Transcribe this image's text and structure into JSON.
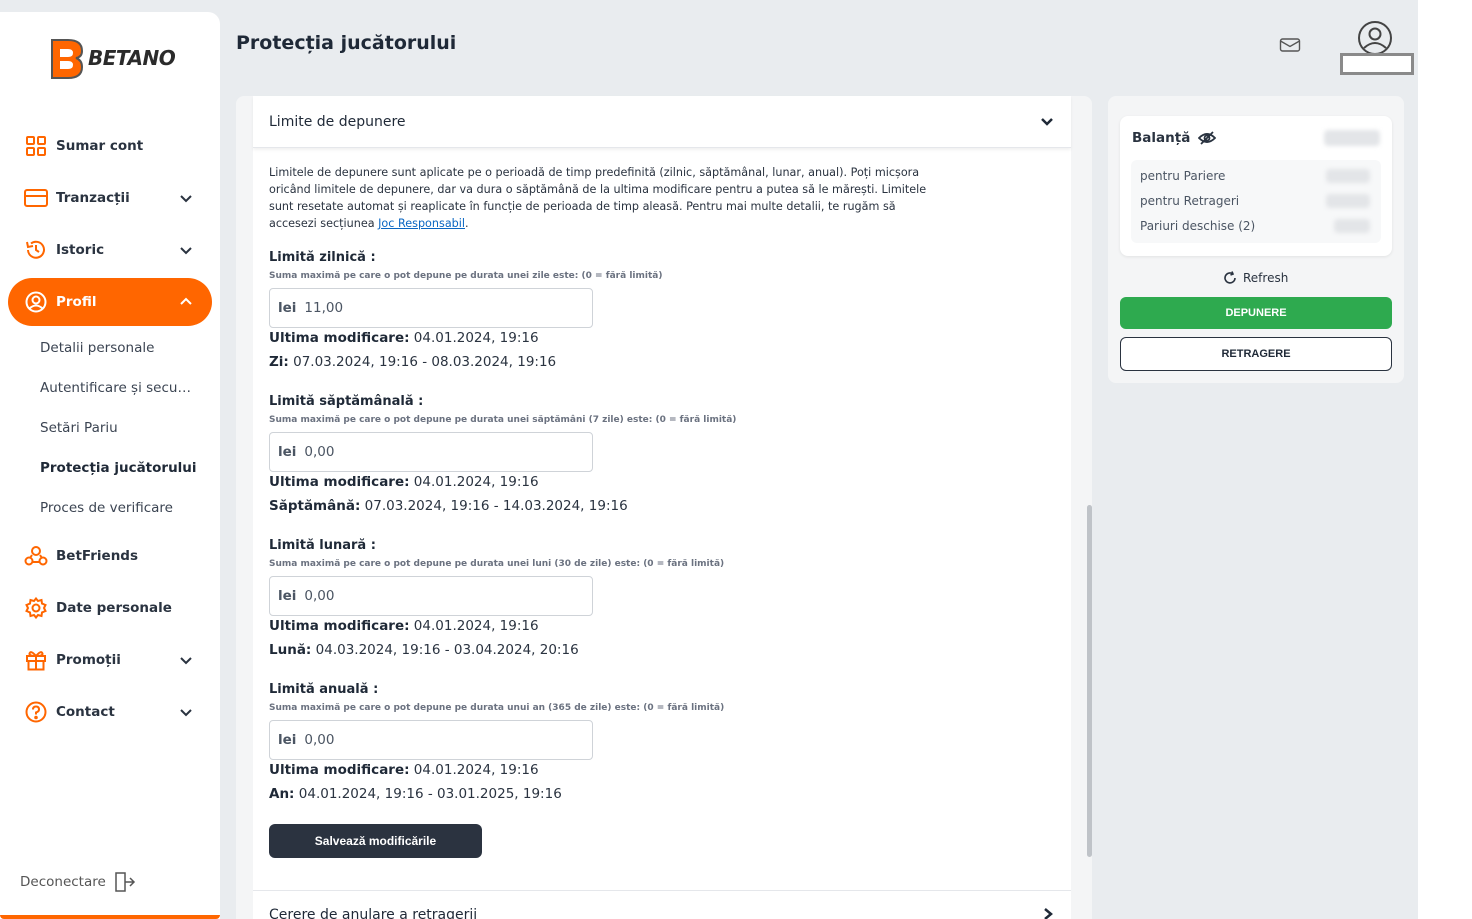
{
  "brand": {
    "logo_text": "BETANO",
    "accent": "#ff6600"
  },
  "sidebar": {
    "items": [
      {
        "label": "Sumar cont",
        "icon": "grid-icon"
      },
      {
        "label": "Tranzacții",
        "icon": "credit-card-icon"
      },
      {
        "label": "Istoric",
        "icon": "history-icon"
      },
      {
        "label": "Profil",
        "icon": "user-circle-icon"
      },
      {
        "label": "BetFriends",
        "icon": "friends-icon"
      },
      {
        "label": "Date personale",
        "icon": "gear-icon"
      },
      {
        "label": "Promoții",
        "icon": "gift-icon"
      },
      {
        "label": "Contact",
        "icon": "help-circle-icon"
      }
    ],
    "profile_sub": [
      "Detalii personale",
      "Autentificare și securitate",
      "Setări Pariu",
      "Protecția jucătorului",
      "Proces de verificare"
    ],
    "logout": "Deconectare"
  },
  "header": {
    "title": "Protecția jucătorului"
  },
  "accordion": {
    "title": "Limite de depunere",
    "intro": "Limitele de depunere sunt aplicate pe o perioadă de timp predefinită (zilnic, săptămânal, lunar, anual). Poți micșora oricând limitele de depunere, dar va dura o săptămână de la ultima modificare pentru a putea să le mărești. Limitele sunt resetate automat și reaplicate în funcție de perioada de timp aleasă. Pentru mai multe detalii, te rugăm să accesezi secțiunea ",
    "intro_link": "Joc Responsabil",
    "intro_end": ".",
    "currency": "lei",
    "last_mod_label": "Ultima modificare:",
    "limits": [
      {
        "title": "Limită zilnică :",
        "sub": "Suma maximă pe care o pot depune pe durata unei zile este: (0 = fără limită)",
        "value": "11,00",
        "last_mod": " 04.01.2024, 19:16",
        "period_label": "Zi:",
        "period": " 07.03.2024, 19:16 - 08.03.2024, 19:16"
      },
      {
        "title": "Limită săptămânală :",
        "sub": "Suma maximă pe care o pot depune pe durata unei săptămâni (7 zile) este: (0 = fără limită)",
        "value": "0,00",
        "last_mod": " 04.01.2024, 19:16",
        "period_label": "Săptămână:",
        "period": " 07.03.2024, 19:16 - 14.03.2024, 19:16"
      },
      {
        "title": "Limită lunară :",
        "sub": "Suma maximă pe care o pot depune pe durata unei luni (30 de zile) este: (0 = fără limită)",
        "value": "0,00",
        "last_mod": " 04.01.2024, 19:16",
        "period_label": "Lună:",
        "period": " 04.03.2024, 19:16 - 03.04.2024, 20:16"
      },
      {
        "title": "Limită anuală :",
        "sub": "Suma maximă pe care o pot depune pe durata unui an (365 de zile) este: (0 = fără limită)",
        "value": "0,00",
        "last_mod": " 04.01.2024, 19:16",
        "period_label": "An:",
        "period": " 04.01.2024, 19:16 - 03.01.2025, 19:16"
      }
    ],
    "save_label": "Salvează modificările",
    "next_title": "Cerere de anulare a retragerii"
  },
  "balance": {
    "title": "Balanță",
    "rows": [
      "pentru Pariere",
      "pentru Retrageri",
      "Pariuri deschise  (2)"
    ],
    "refresh": "Refresh",
    "deposit": "DEPUNERE",
    "withdraw": "RETRAGERE",
    "deposit_color": "#2eaa4f"
  }
}
